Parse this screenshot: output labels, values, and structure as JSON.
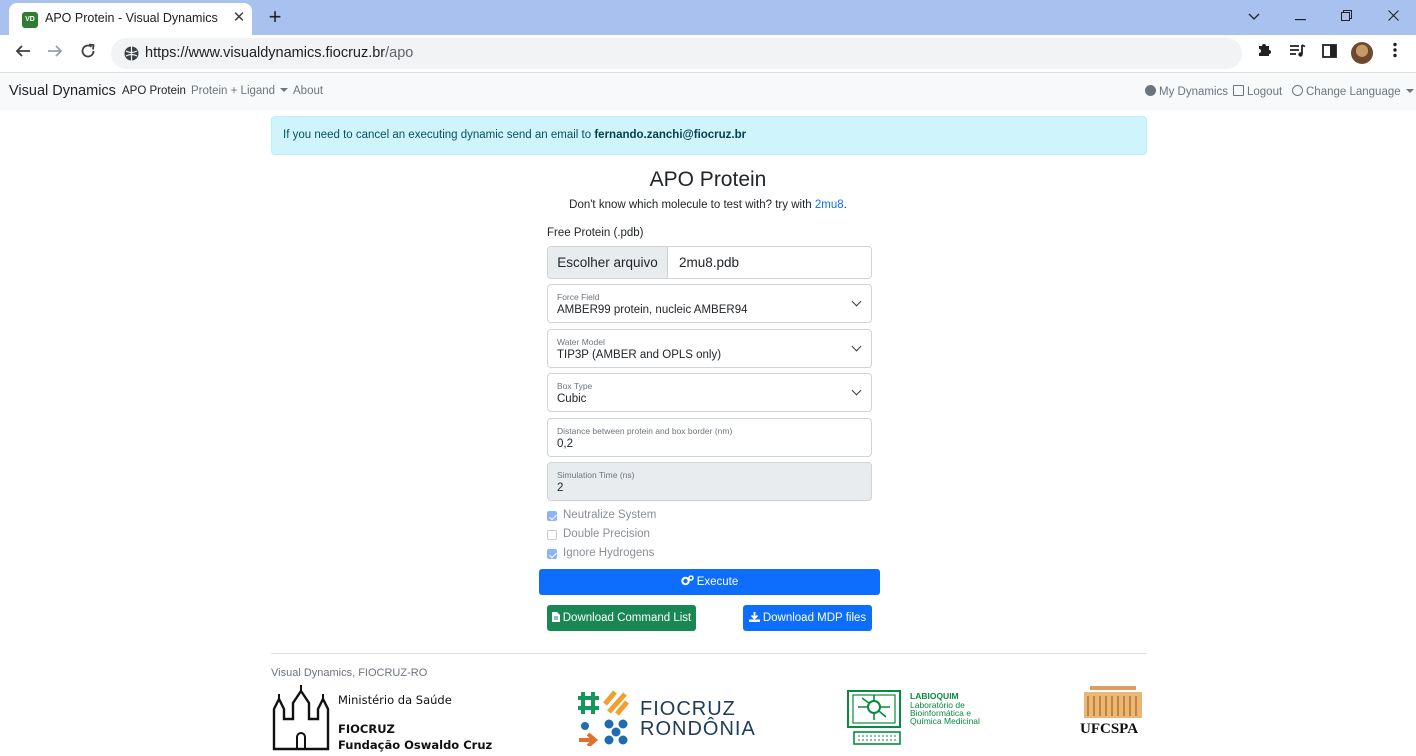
{
  "browser": {
    "tab_title": "APO Protein - Visual Dynamics",
    "favicon_text": "VD",
    "url_host": "https://www.visualdynamics.fiocruz.br",
    "url_path": "/apo"
  },
  "nav": {
    "brand": "Visual Dynamics",
    "links": [
      "APO Protein",
      "Protein + Ligand",
      "About"
    ],
    "right": [
      "My Dynamics",
      "Logout",
      "Change Language"
    ]
  },
  "alert": {
    "text": "If you need to cancel an executing dynamic send an email to ",
    "email": "fernando.zanchi@fiocruz.br"
  },
  "main": {
    "title": "APO Protein",
    "subtitle_prefix": "Don't know which molecule to test with? try with ",
    "subtitle_link": "2mu8",
    "subtitle_suffix": "."
  },
  "form": {
    "file_label": "Free Protein (.pdb)",
    "file_button": "Escolher arquivo",
    "file_name": "2mu8.pdb",
    "fields": [
      {
        "label": "Force Field",
        "value": "AMBER99 protein, nucleic AMBER94"
      },
      {
        "label": "Water Model",
        "value": "TIP3P (AMBER and OPLS only)"
      },
      {
        "label": "Box Type",
        "value": "Cubic"
      },
      {
        "label": "Distance between protein and box border (nm)",
        "value": "0,2"
      },
      {
        "label": "Simulation Time (ns)",
        "value": "2"
      }
    ],
    "checks": [
      {
        "label": "Neutralize System",
        "checked": true
      },
      {
        "label": "Double Precision",
        "checked": false
      },
      {
        "label": "Ignore Hydrogens",
        "checked": true
      }
    ],
    "execute": "Execute",
    "download_commands": "Download Command List",
    "download_mdp": "Download MDP files"
  },
  "footer": {
    "text": "Visual Dynamics, FIOCRUZ-RO",
    "ms_line1": "Ministério da Saúde",
    "ms_line2": "FIOCRUZ",
    "ms_line3": "Fundação Oswaldo Cruz",
    "fio_line1": "FIOCRUZ",
    "fio_line2": "RONDÔNIA",
    "lab_line1": "LABIOQUIM",
    "lab_line2": "Laboratório de",
    "lab_line3": "Bioinformática e",
    "lab_line4": "Química Medicinal",
    "ufc_text": "UFCSPA"
  },
  "colors": {
    "primary": "#0d6efd",
    "success": "#198754",
    "alert_bg": "#cff4fc",
    "tabstrip": "#a9c1ee"
  }
}
